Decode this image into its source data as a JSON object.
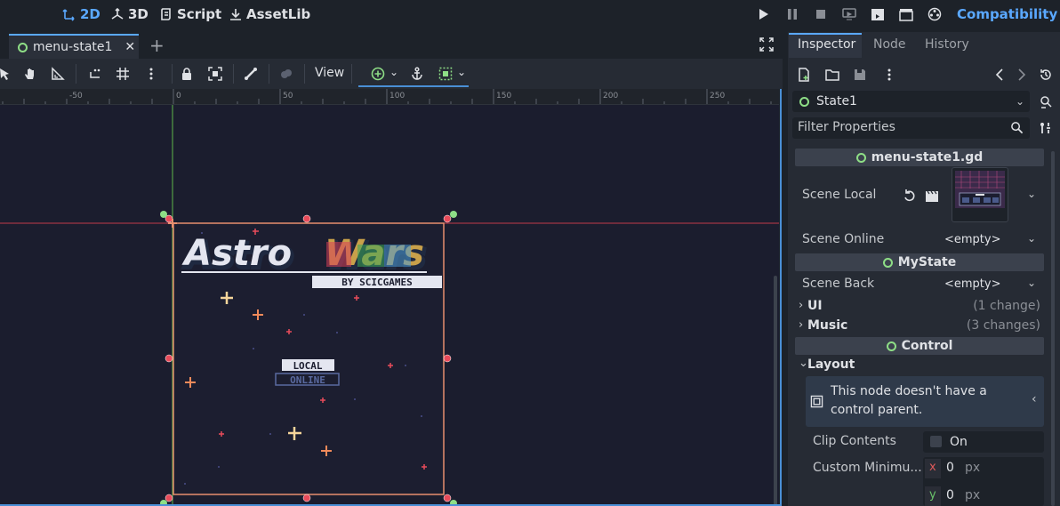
{
  "workspaces": [
    {
      "label": "2D",
      "active": true
    },
    {
      "label": "3D",
      "active": false
    },
    {
      "label": "Script",
      "active": false
    },
    {
      "label": "AssetLib",
      "active": false
    }
  ],
  "renderer": "Compatibility",
  "scene_tab": {
    "label": "menu-state1",
    "close": "✕",
    "add": "+"
  },
  "toolbar": {
    "view_label": "View"
  },
  "ruler": {
    "ticks": [
      "-50",
      "0",
      "50",
      "100",
      "150",
      "200",
      "250"
    ]
  },
  "inspector": {
    "tabs": [
      "Inspector",
      "Node",
      "History"
    ],
    "node_name": "State1",
    "filter_placeholder": "Filter Properties",
    "script_header": "menu-state1.gd",
    "scene_local_label": "Scene Local",
    "scene_online_label": "Scene Online",
    "scene_online_value": "<empty>",
    "mystate_header": "MyState",
    "scene_back_label": "Scene Back",
    "scene_back_value": "<empty>",
    "ui_label": "UI",
    "ui_changes": "(1 change)",
    "music_label": "Music",
    "music_changes": "(3 changes)",
    "control_header": "Control",
    "layout_label": "Layout",
    "layout_warning": "This node doesn't have a control parent.",
    "clip_label": "Clip Contents",
    "clip_value": "On",
    "min_size_label": "Custom Minimu...",
    "min_x_label": "x",
    "min_x_value": "0",
    "min_y_label": "y",
    "min_y_value": "0",
    "unit": "px"
  },
  "game_preview": {
    "title_left": "Astro",
    "title_right": "Wars",
    "byline": "BY SCICGAMES",
    "menu_local": "LOCAL",
    "menu_online": "ONLINE"
  },
  "colors": {
    "accent": "#5aa8ff",
    "node_green": "#8ede86",
    "selection": "#e88f6e",
    "handle": "#e84b5a"
  }
}
